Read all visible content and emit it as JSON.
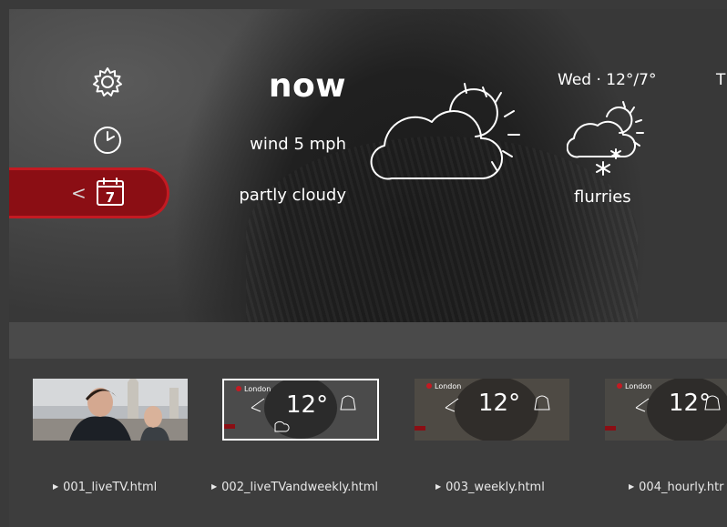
{
  "weather_app": {
    "sidebar": {
      "items": [
        {
          "name": "settings",
          "icon": "gear-icon"
        },
        {
          "name": "hourly",
          "icon": "clock-icon"
        },
        {
          "name": "weekly",
          "icon": "calendar-icon",
          "calendar_number": "7",
          "active": true
        }
      ],
      "back_glyph": "<"
    },
    "current": {
      "title": "now",
      "wind": "wind 5 mph",
      "condition": "partly cloudy",
      "icon": "partly-cloudy-icon"
    },
    "forecast": [
      {
        "day": "Wed · 12°/7°",
        "condition": "flurries",
        "icon": "flurries-icon"
      },
      {
        "day": "T",
        "condition": "",
        "icon": ""
      }
    ]
  },
  "thumbnails": [
    {
      "file": "001_liveTV.html",
      "selected": false
    },
    {
      "file": "002_liveTVandweekly.html",
      "selected": true
    },
    {
      "file": "003_weekly.html",
      "selected": false
    },
    {
      "file": "004_hourly.htr",
      "selected": false
    }
  ],
  "mini": {
    "city": "London",
    "temp": "12°"
  },
  "colors": {
    "accent_red": "#8b0e14",
    "accent_border": "#c41a22",
    "text": "#ffffff",
    "strip_bg": "#3d3d3d"
  }
}
